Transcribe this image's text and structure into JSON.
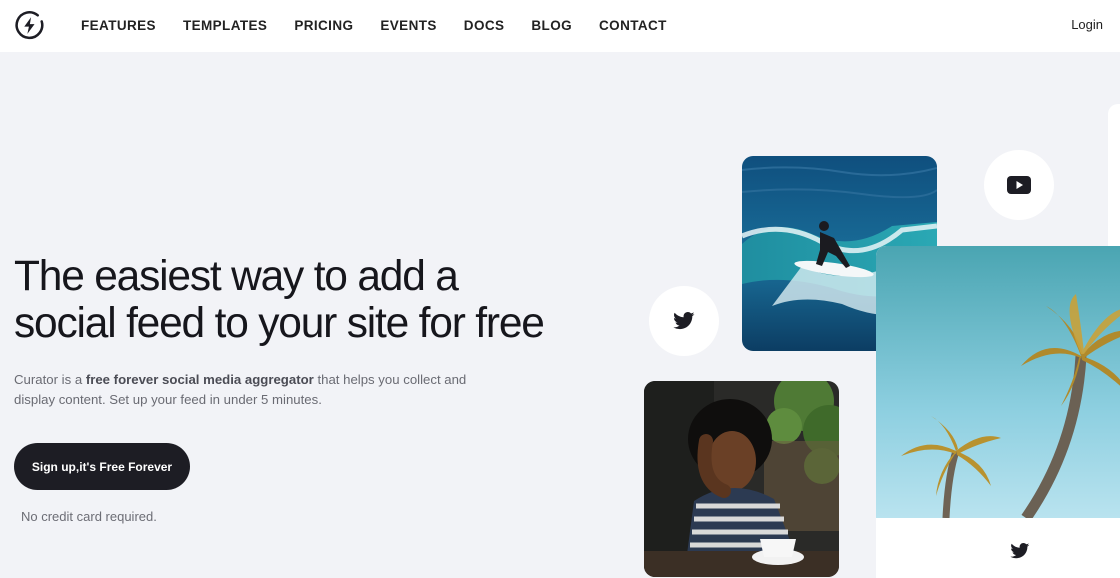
{
  "nav": {
    "links": [
      {
        "label": "FEATURES"
      },
      {
        "label": "TEMPLATES"
      },
      {
        "label": "PRICING"
      },
      {
        "label": "EVENTS"
      },
      {
        "label": "DOCS"
      },
      {
        "label": "BLOG"
      },
      {
        "label": "CONTACT"
      }
    ],
    "login_label": "Login",
    "logo_icon": "bolt-circle-icon"
  },
  "hero": {
    "title_line1": "The easiest way to add a",
    "title_line2": "social feed to your site for free",
    "subtitle": {
      "part1": "Curator is a ",
      "bold": "free forever social media aggregator",
      "part2": " that helps you collect and display content. Set up your feed in under 5 minutes."
    },
    "cta_label": "Sign up,it's Free Forever",
    "note": "No credit card required."
  },
  "collage": {
    "twitter_bubble_icon": "twitter-icon",
    "youtube_bubble_icon": "youtube-icon",
    "photo_surfer": "surfer-photo",
    "photo_woman": "woman-with-coffee-photo",
    "photo_palms": "palm-trees-photo",
    "post_network_icon": "twitter-icon"
  },
  "colors": {
    "background": "#f2f3f7",
    "nav_background": "#ffffff",
    "cta_background": "#1d1d24",
    "text_primary": "#16161c",
    "text_muted": "#6a6b73"
  }
}
